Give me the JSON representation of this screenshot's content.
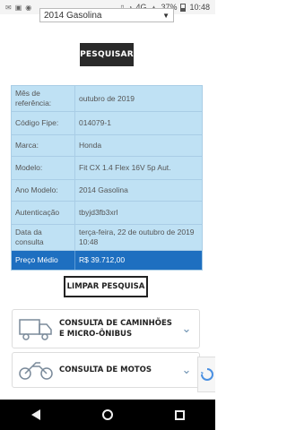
{
  "status_bar": {
    "time": "10:48",
    "battery": "37%",
    "network": "4G"
  },
  "form": {
    "year_select_value": "2014 Gasolina",
    "search_button": "PESQUISAR",
    "clear_button": "LIMPAR PESQUISA"
  },
  "result": {
    "rows": [
      {
        "label": "Mês de referência:",
        "value": "outubro de 2019"
      },
      {
        "label": "Código Fipe:",
        "value": "014079-1"
      },
      {
        "label": "Marca:",
        "value": "Honda"
      },
      {
        "label": "Modelo:",
        "value": "Fit CX 1.4 Flex 16V 5p Aut."
      },
      {
        "label": "Ano Modelo:",
        "value": "2014 Gasolina"
      },
      {
        "label": "Autenticação",
        "value": "tbyjd3fb3xrl"
      },
      {
        "label": "Data da consulta",
        "value": "terça-feira, 22 de outubro de 2019 10:48"
      }
    ],
    "price": {
      "label": "Preço Médio",
      "value": "R$ 39.712,00"
    }
  },
  "links": {
    "trucks": "CONSULTA DE CAMINHÕES E MICRO-ÔNIBUS",
    "motos": "CONSULTA DE MOTOS"
  },
  "icons": {
    "truck": "truck-icon",
    "motorcycle": "motorcycle-icon",
    "chevron": "chevron-down-icon"
  },
  "colors": {
    "table_bg": "#bfe1f4",
    "price_bg": "#1e6fc0",
    "button_dark": "#2a2a2a"
  }
}
